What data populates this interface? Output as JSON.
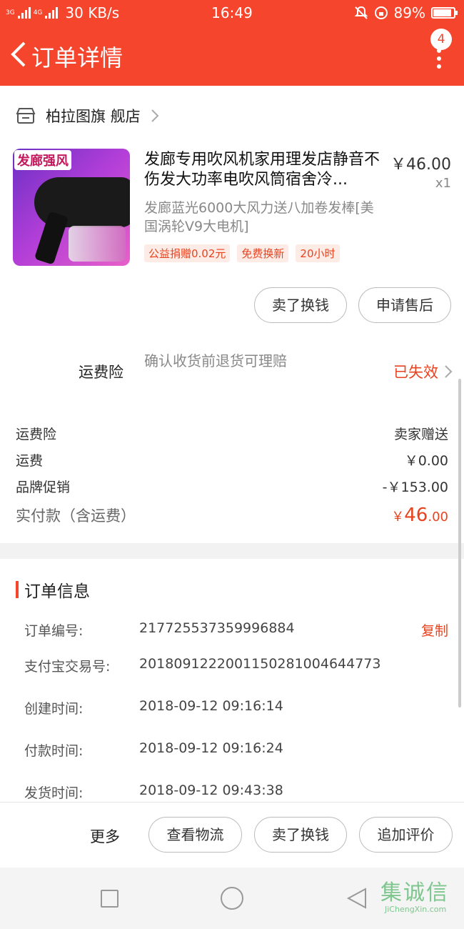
{
  "status_bar": {
    "signal_1": "3G",
    "signal_2": "4G",
    "speed": "30 KB/s",
    "time": "16:49",
    "battery": "89%",
    "battery_level": 0.89
  },
  "nav": {
    "title": "订单详情",
    "badge_count": "4"
  },
  "shop": {
    "name": "柏拉图旗 舰店"
  },
  "product": {
    "title": "发廊专用吹风机家用理发店静音不伤发大功率电吹风筒宿舍冷...",
    "price": "￥46.00",
    "qty": "x1",
    "subtitle": "发廊蓝光6000大风力送八加卷发棒[美国涡轮V9大电机]",
    "tags": [
      "公益捐赠0.02元",
      "免费换新",
      "20小时"
    ],
    "thumb_banner": "发廊强风"
  },
  "item_actions": {
    "sell": "卖了换钱",
    "after_sale": "申请售后"
  },
  "insurance": {
    "label": "运费险",
    "desc": "确认收货前退货可理赔",
    "status": "已失效"
  },
  "summary": {
    "rows": [
      {
        "k": "运费险",
        "v": "卖家赠送"
      },
      {
        "k": "运费",
        "v": "￥0.00"
      },
      {
        "k": "品牌促销",
        "v": "-￥153.00"
      }
    ],
    "total_label": "实付款（含运费）",
    "total_currency": "￥",
    "total_int": "46",
    "total_dec": ".00"
  },
  "order_info": {
    "title": "订单信息",
    "copy": "复制",
    "rows": [
      {
        "k": "订单编号:",
        "v": "217725537359996884"
      },
      {
        "k": "支付宝交易号:",
        "v": "2018091222001150281004644773"
      },
      {
        "k": "创建时间:",
        "v": "2018-09-12 09:16:14"
      },
      {
        "k": "付款时间:",
        "v": "2018-09-12 09:16:24"
      },
      {
        "k": "发货时间:",
        "v": "2018-09-12 09:43:38"
      }
    ]
  },
  "bottom_actions": {
    "more": "更多",
    "logistics": "查看物流",
    "sell": "卖了换钱",
    "review": "追加评价"
  },
  "watermark": {
    "cn": "集诚信",
    "en": "JiChengXin.com"
  },
  "colors": {
    "brand": "#f5452d",
    "accent": "#e8431f"
  }
}
